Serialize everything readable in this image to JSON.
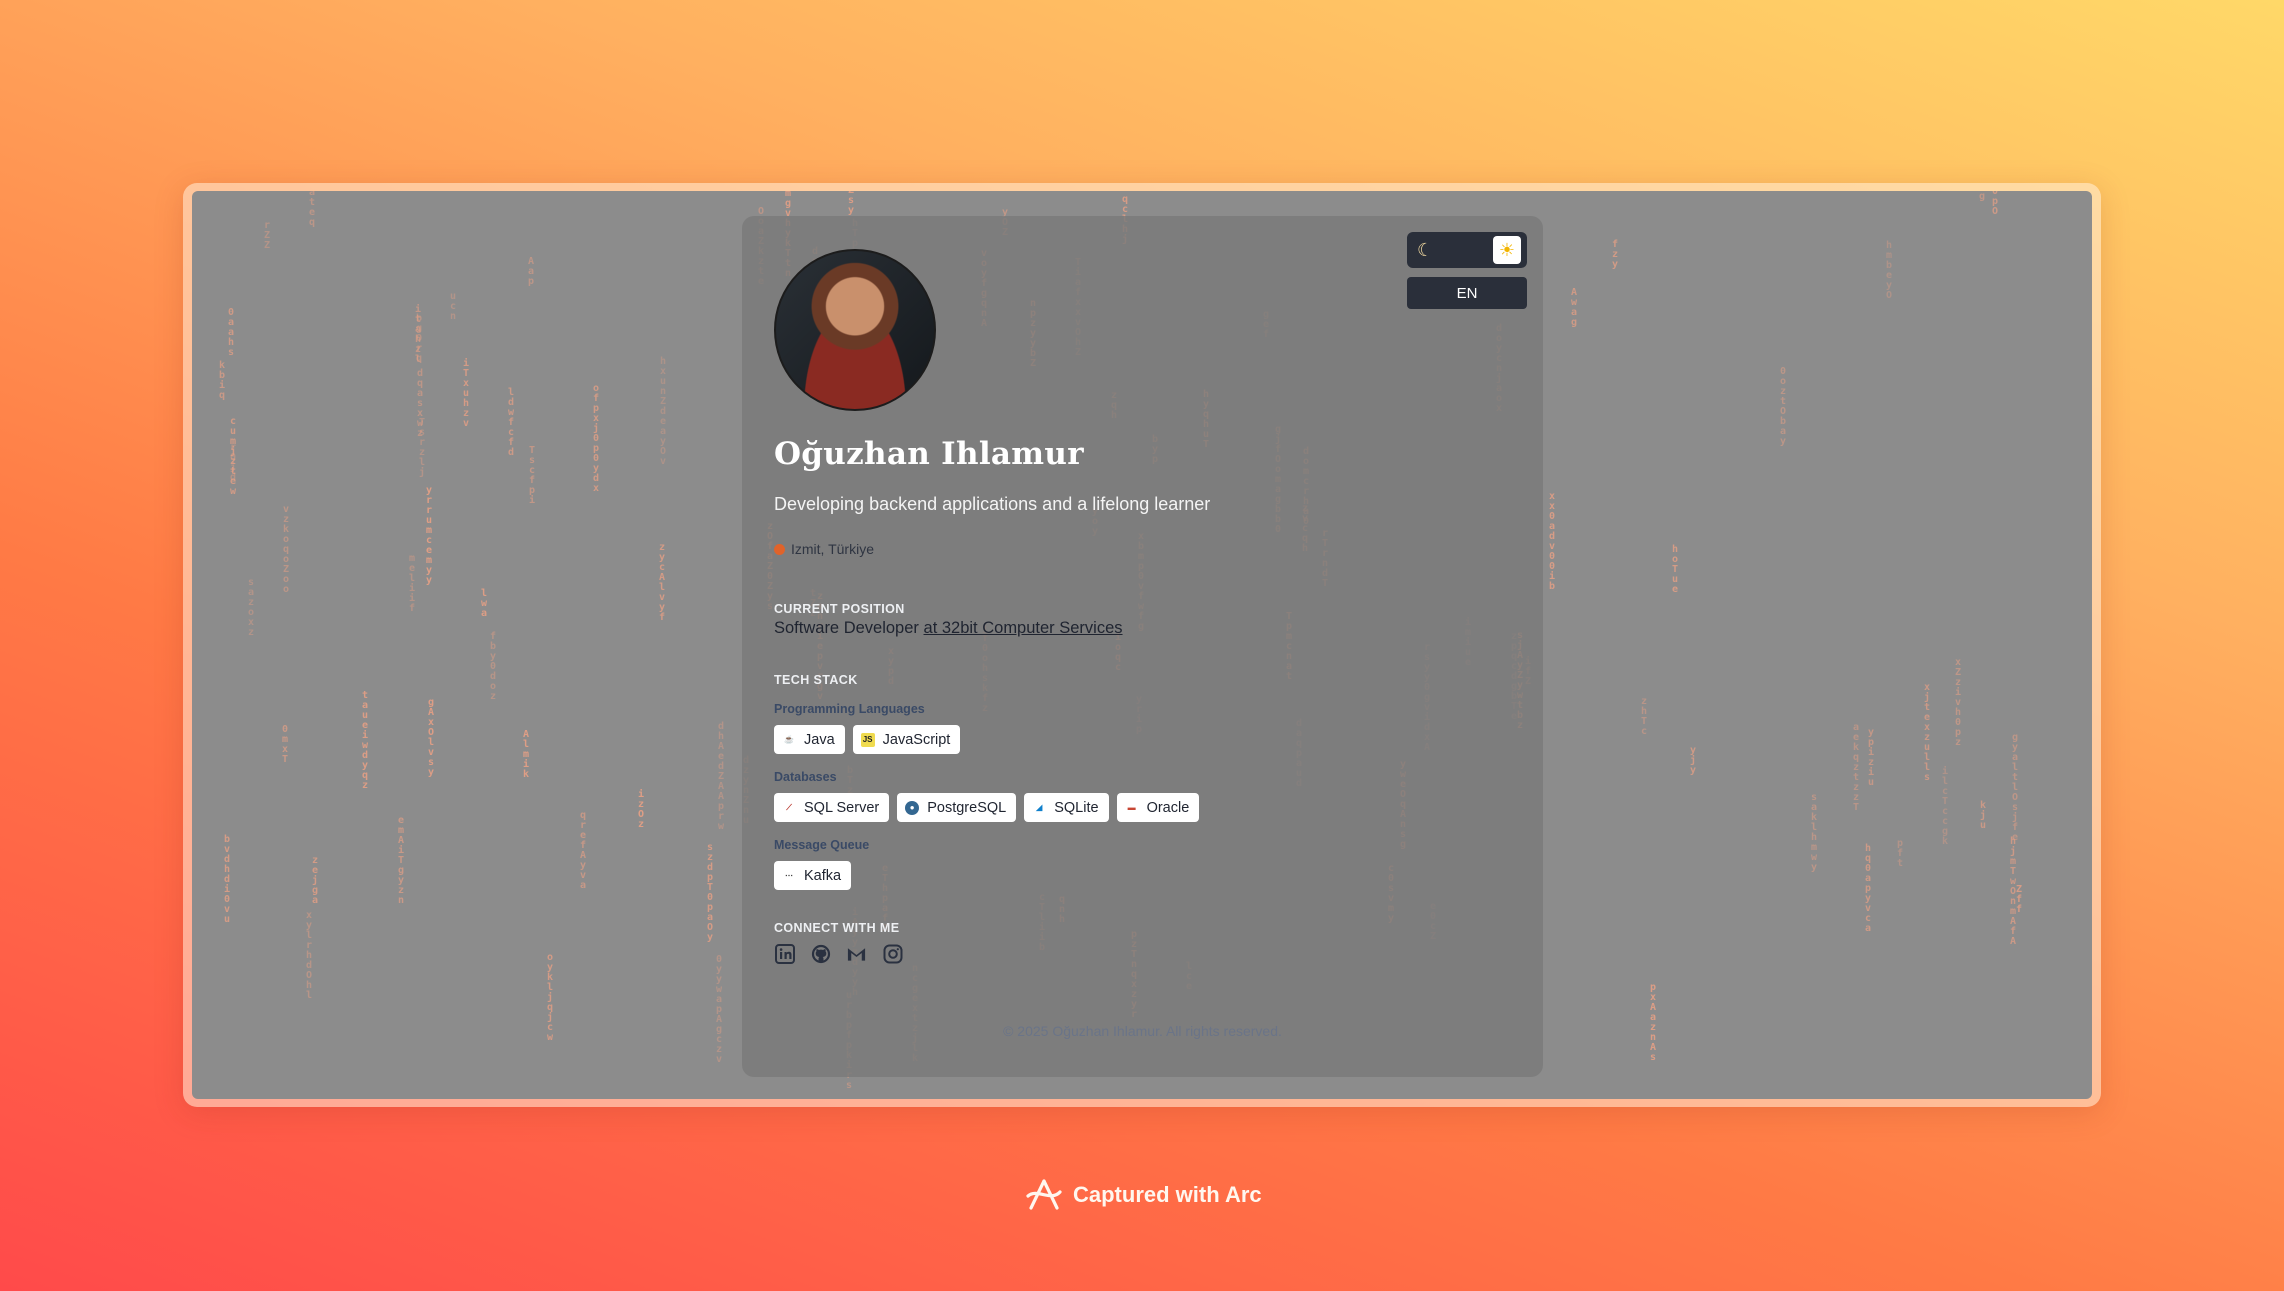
{
  "profile": {
    "name": "Oğuzhan Ihlamur",
    "tagline": "Developing backend applications and a lifelong learner",
    "location": "Izmit, Türkiye"
  },
  "controls": {
    "theme_dark_icon": "moon-icon",
    "theme_light_icon": "sun-icon",
    "language": "EN"
  },
  "current_position": {
    "heading": "CURRENT POSITION",
    "role": "Software Developer",
    "company_link": "at 32bit Computer Services"
  },
  "tech_stack": {
    "heading": "TECH STACK",
    "groups": [
      {
        "label": "Programming Languages",
        "items": [
          "Java",
          "JavaScript"
        ]
      },
      {
        "label": "Databases",
        "items": [
          "SQL Server",
          "PostgreSQL",
          "SQLite",
          "Oracle"
        ]
      },
      {
        "label": "Message Queue",
        "items": [
          "Kafka"
        ]
      }
    ]
  },
  "connect": {
    "heading": "CONNECT WITH ME",
    "links": [
      "linkedin-icon",
      "github-icon",
      "gmail-icon",
      "instagram-icon"
    ]
  },
  "footer": "© 2025 Oğuzhan Ihlamur. All rights reserved.",
  "capture_badge": "Captured with Arc",
  "colors": {
    "accent_dark": "#2a2f3a",
    "rain": "#e8a085",
    "background_start": "#ff4a4a",
    "background_end": "#ffd868"
  }
}
